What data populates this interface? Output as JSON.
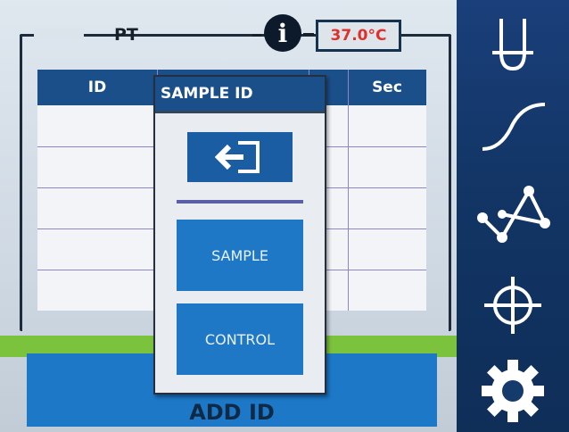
{
  "header": {
    "title": "PT",
    "temperature": "37.0°C",
    "info_icon": "info-icon"
  },
  "table": {
    "columns": [
      "ID",
      "",
      "",
      "Sec"
    ],
    "rows": [
      [
        "",
        "",
        "",
        ""
      ],
      [
        "",
        "",
        "",
        ""
      ],
      [
        "",
        "",
        "",
        ""
      ],
      [
        "",
        "",
        "",
        ""
      ],
      [
        "",
        "",
        "",
        ""
      ]
    ]
  },
  "popup": {
    "title": "SAMPLE ID",
    "login_icon": "login-arrow-icon",
    "items": [
      {
        "label": "SAMPLE"
      },
      {
        "label": "CONTROL"
      }
    ]
  },
  "footer": {
    "add_label": "ADD ID"
  },
  "sidebar": {
    "items": [
      {
        "icon": "test-tube-icon"
      },
      {
        "icon": "sigmoid-curve-icon"
      },
      {
        "icon": "graph-network-icon"
      },
      {
        "icon": "crosshair-icon"
      },
      {
        "icon": "gear-icon"
      }
    ]
  },
  "colors": {
    "primary": "#1a4f8a",
    "button": "#1f78c6",
    "sidebar": "#123565",
    "accent_green": "#7bc33d",
    "temperature_text": "#e0302c"
  }
}
